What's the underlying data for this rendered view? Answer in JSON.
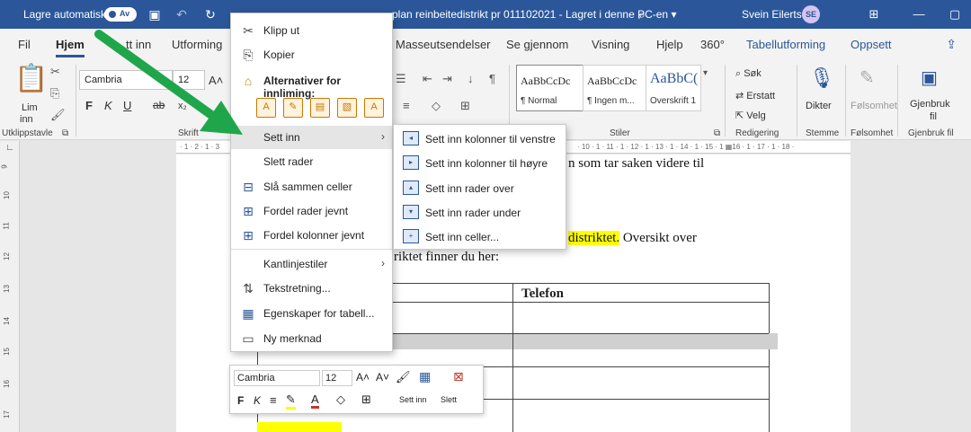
{
  "titlebar": {
    "autosave_label": "Lagre automatisk",
    "toggle_state": "Av",
    "doc_title": "plan reinbeitedistrikt pr 011102021  -  Lagret i denne PC-en",
    "user_name": "Svein Eilertsen",
    "user_initials": "SE",
    "dropdown_glyph": "▾"
  },
  "tabs": {
    "file": "Fil",
    "home": "Hjem",
    "insert_partial": "tt inn",
    "design": "Utforming",
    "mailings": "Masseutsendelser",
    "review": "Se gjennom",
    "view": "Visning",
    "help": "Hjelp",
    "three60": "360°",
    "table_design": "Tabellutforming",
    "layout": "Oppsett"
  },
  "ribbon": {
    "paste_label": "Lim",
    "paste_label2": "inn",
    "clipboard_group": "Utklippstavle",
    "font_name": "Cambria",
    "font_size": "12",
    "bold": "F",
    "italic": "K",
    "underline": "U",
    "font_group": "Skrift",
    "styles_group": "Stiler",
    "styles": [
      {
        "sample": "AaBbCcDc",
        "name": "¶ Normal"
      },
      {
        "sample": "AaBbCcDc",
        "name": "¶ Ingen m..."
      },
      {
        "sample": "AaBbC(",
        "name": "Overskrift 1"
      }
    ],
    "find": "Søk",
    "replace": "Erstatt",
    "select": "Velg",
    "editing_group": "Redigering",
    "dictate": "Dikter",
    "voice_group": "Stemme",
    "sensitivity": "Følsomhet",
    "sensitivity_group": "Følsomhet",
    "reuse": "Gjenbruk",
    "reuse2": "fil",
    "reuse_group": "Gjenbruk fil"
  },
  "ruler": {
    "top_left_marks": "· 1 · 2 · 1 · 3",
    "top_right_marks": "· 10 · 1 · 11 · 1 · 12 · 1 · 13 · 1 · 14 · 1 · 15 · 1 ▦16 · 1 · 17 · 1 · 18 ·",
    "left_marks": [
      "9",
      "10",
      "11",
      "12",
      "13",
      "14",
      "15",
      "16",
      "17"
    ]
  },
  "document": {
    "line1_tail": "n som tar saken videre til",
    "line2_highlight": "distriktet.",
    "line2_rest": " Oversikt over",
    "line3": "riktet finner du her:",
    "table_header": "Telefon"
  },
  "context_menu": {
    "cut": "Klipp ut",
    "copy": "Kopier",
    "paste_options": "Alternativer for innliming:",
    "insert": "Sett inn",
    "delete_rows": "Slett rader",
    "merge_cells": "Slå sammen celler",
    "distribute_rows": "Fordel rader jevnt",
    "distribute_cols": "Fordel kolonner jevnt",
    "border_styles": "Kantlinjestiler",
    "text_direction": "Tekstretning...",
    "table_props": "Egenskaper for tabell...",
    "new_comment": "Ny merknad"
  },
  "submenu": {
    "cols_left": "Sett inn kolonner til venstre",
    "cols_right": "Sett inn kolonner til høyre",
    "rows_above": "Sett inn rader over",
    "rows_below": "Sett inn rader under",
    "cells": "Sett inn celler..."
  },
  "mini_toolbar": {
    "font_name": "Cambria",
    "font_size": "12",
    "bold": "F",
    "italic": "K",
    "insert": "Sett inn",
    "delete": "Slett"
  },
  "colors": {
    "title_bar": "#2b579a",
    "accent": "#2b579a",
    "arrow": "#1fa64a",
    "highlight": "#ffff00"
  }
}
